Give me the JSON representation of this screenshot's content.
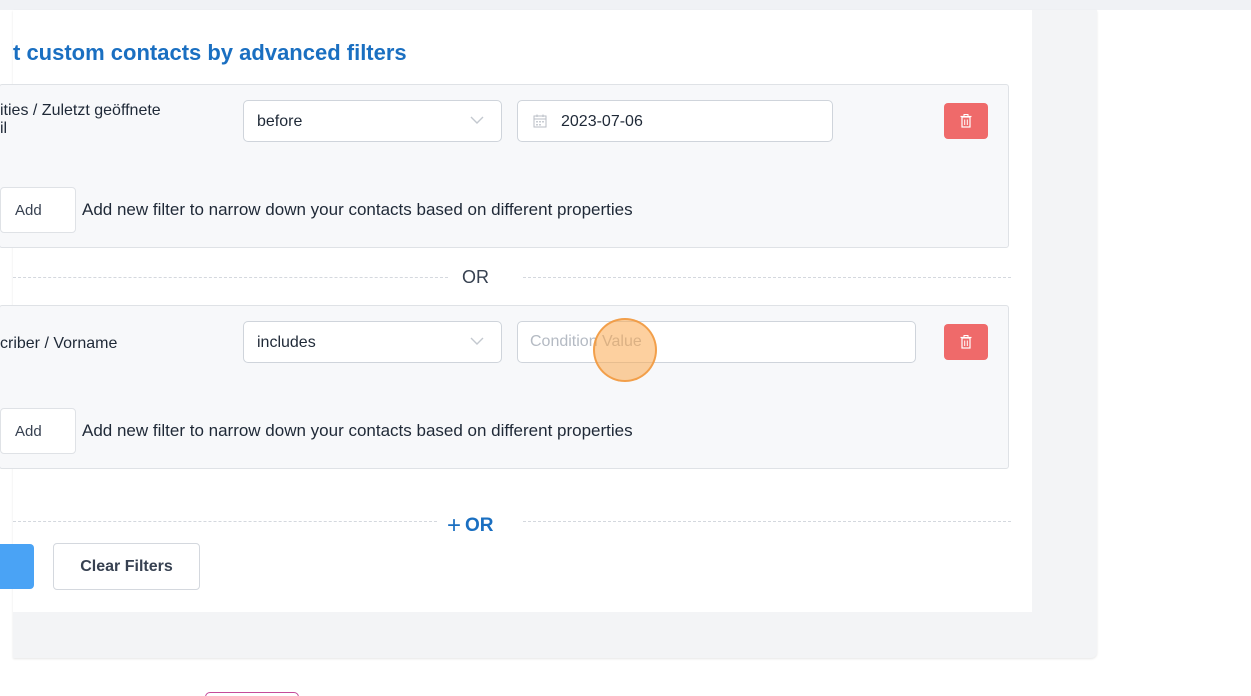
{
  "section": {
    "title": "t custom contacts by advanced filters"
  },
  "groups": [
    {
      "property": "ities / Zuletzt geöffnete\nil",
      "operator": "before",
      "value": "2023-07-06",
      "add_label": "Add",
      "add_hint": "Add new filter to narrow down your contacts based on different properties"
    },
    {
      "property": "criber / Vorname",
      "operator": "includes",
      "value": "",
      "value_placeholder": "Condition Value",
      "add_label": "Add",
      "add_hint": "Add new filter to narrow down your contacts based on different properties"
    }
  ],
  "separator": {
    "or_label": "OR"
  },
  "add_or": {
    "plus": "+",
    "label": "OR"
  },
  "actions": {
    "clear_label": "Clear Filters"
  },
  "colors": {
    "accent": "#1a6fc1",
    "danger": "#ef6a6a",
    "primary_button": "#4aa3f5"
  },
  "icons": {
    "select_arrow": "chevron-down-icon",
    "date": "calendar-icon",
    "delete": "trash-icon"
  }
}
